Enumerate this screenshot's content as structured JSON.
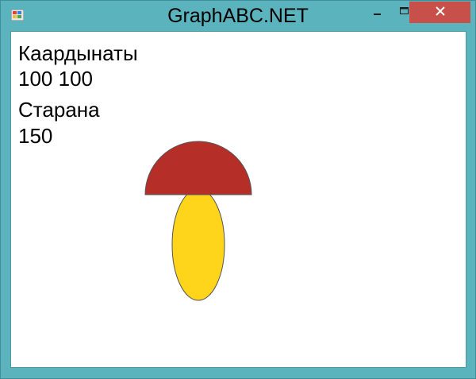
{
  "window": {
    "title": "GraphABC.NET",
    "titlebar_color": "#5ab3bd",
    "close_button_color": "#c7504a"
  },
  "icons": {
    "app": "app-icon",
    "minimize": "minimize-icon",
    "maximize": "maximize-icon",
    "close": "close-icon"
  },
  "canvas": {
    "coords_label": "Каардынаты",
    "coords_value": "100 100",
    "side_label": "Старана",
    "side_value": "150"
  },
  "drawing": {
    "cap_color": "#b52e28",
    "stem_color": "#fed51b",
    "outline_color": "#555555"
  }
}
